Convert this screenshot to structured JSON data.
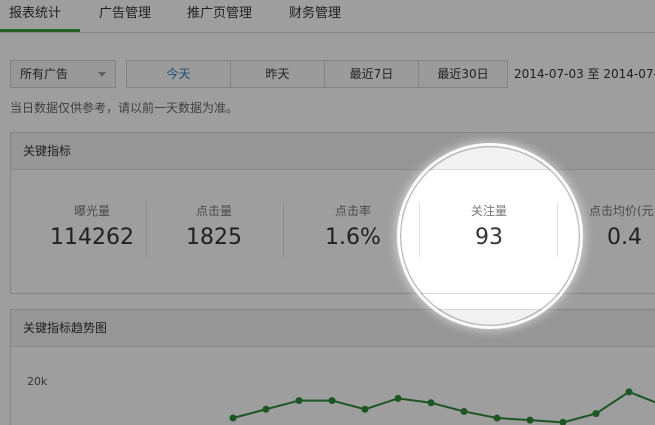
{
  "nav": {
    "tabs": [
      "报表统计",
      "广告管理",
      "推广页管理",
      "财务管理"
    ]
  },
  "filter": {
    "select_value": "所有广告",
    "ranges": [
      "今天",
      "昨天",
      "最近7日",
      "最近30日"
    ],
    "date_range": "2014-07-03 至 2014-07-"
  },
  "hint": "当日数据仅供参考，请以前一天数据为准。",
  "key_metrics": {
    "title": "关键指标",
    "items": [
      {
        "label": "曝光量",
        "value": "114262"
      },
      {
        "label": "点击量",
        "value": "1825"
      },
      {
        "label": "点击率",
        "value": "1.6%"
      },
      {
        "label": "关注量",
        "value": "93"
      },
      {
        "label": "点击均价(元",
        "value": "0.4"
      }
    ]
  },
  "trend": {
    "title": "关键指标趋势图",
    "y_tick": "20k"
  },
  "chart_data": {
    "type": "line",
    "yticks": [
      "20k"
    ],
    "series": [
      {
        "values": [
          11.5,
          13.5,
          15.5,
          15.5,
          13.5,
          16,
          15,
          13,
          11.5,
          11,
          10.5,
          12.5,
          17.5,
          14.5
        ]
      }
    ],
    "color": "#2e8b3a"
  },
  "colors": {
    "accent": "#3a9a3f",
    "active_range": "#2b7bb5",
    "line": "#2e8b3a"
  }
}
